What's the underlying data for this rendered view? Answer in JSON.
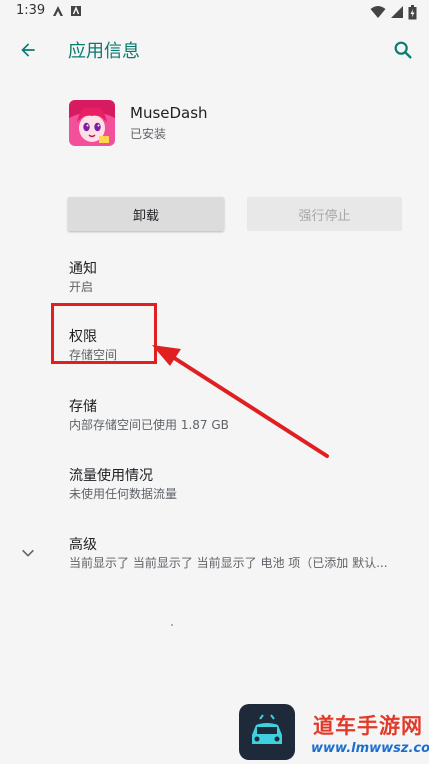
{
  "status_bar": {
    "time": "1:39",
    "icons": [
      "app-a-icon",
      "app-box-icon",
      "wifi-icon",
      "signal-icon",
      "battery-icon"
    ]
  },
  "toolbar": {
    "back_icon": "arrow-back-icon",
    "title": "应用信息",
    "search_icon": "search-icon",
    "accent": "#0b7a6f"
  },
  "app": {
    "name": "MuseDash",
    "status": "已安装"
  },
  "buttons": {
    "uninstall": "卸载",
    "force_stop": "强行停止"
  },
  "prefs": [
    {
      "title": "通知",
      "summary": "开启"
    },
    {
      "title": "权限",
      "summary": "存储空间"
    },
    {
      "title": "存储",
      "summary": "内部存储空间已使用 1.87 GB"
    },
    {
      "title": "流量使用情况",
      "summary": "未使用任何数据流量"
    },
    {
      "title": "高级",
      "summary": "当前显示了 当前显示了 当前显示了 电池 项（已添加 默认..."
    }
  ],
  "annotation": {
    "color": "#e02020"
  },
  "watermark": {
    "title": "道车手游网",
    "url": "www.lmwwsz.com"
  }
}
